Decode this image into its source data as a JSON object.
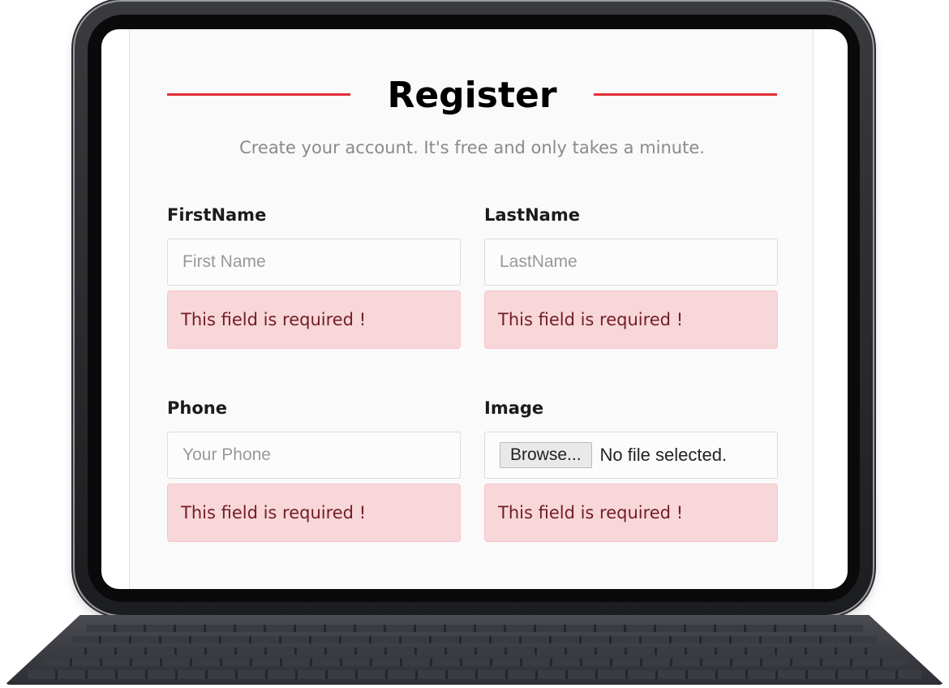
{
  "form": {
    "title": "Register",
    "subtitle": "Create your account. It's free and only takes a minute.",
    "accent_color": "#e32f36",
    "error_bg_color": "#f8d7da",
    "error_text_color": "#721c24",
    "fields": {
      "first_name": {
        "label": "FirstName",
        "placeholder": "First Name",
        "error": "This field is required !"
      },
      "last_name": {
        "label": "LastName",
        "placeholder": "LastName",
        "error": "This field is required !"
      },
      "phone": {
        "label": "Phone",
        "placeholder": "Your Phone",
        "error": "This field is required !"
      },
      "image": {
        "label": "Image",
        "browse_label": "Browse...",
        "file_status": "No file selected.",
        "error": "This field is required !"
      }
    }
  },
  "device": {
    "type": "tablet-with-keyboard"
  }
}
